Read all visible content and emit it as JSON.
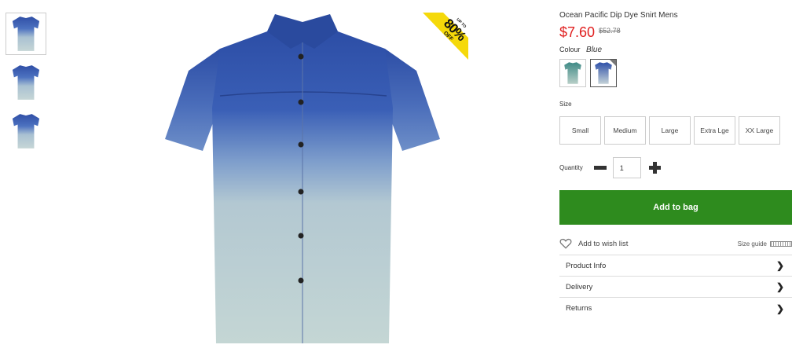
{
  "product": {
    "title": "Ocean Pacific Dip Dye Snirt Mens",
    "price": "$7.60",
    "old_price": "$52.78"
  },
  "promo": {
    "line1": "UP TO",
    "big": "80%",
    "off": "OFF"
  },
  "colour": {
    "label": "Colour",
    "value": "Blue",
    "swatches": [
      {
        "name": "Green",
        "top": "#3e8a86",
        "bottom": "#b8cfc8"
      },
      {
        "name": "Blue",
        "top": "#2d4fa8",
        "bottom": "#c4d2d8",
        "selected": true
      }
    ]
  },
  "size": {
    "label": "Size",
    "options": [
      "Small",
      "Medium",
      "Large",
      "Extra Lge",
      "XX Large"
    ]
  },
  "quantity": {
    "label": "Quantity",
    "value": "1"
  },
  "actions": {
    "add_to_bag": "Add to bag",
    "wish_list": "Add to wish list",
    "size_guide": "Size guide"
  },
  "accordion": [
    "Product Info",
    "Delivery",
    "Returns"
  ],
  "icons": {
    "minus": "minus-icon",
    "plus": "plus-icon",
    "heart": "heart-icon",
    "ruler": "ruler-icon",
    "chevron": "chevron-right-icon"
  },
  "colors": {
    "price": "#e02020",
    "add_button": "#2e8b1e",
    "promo_badge": "#f5d90a"
  }
}
